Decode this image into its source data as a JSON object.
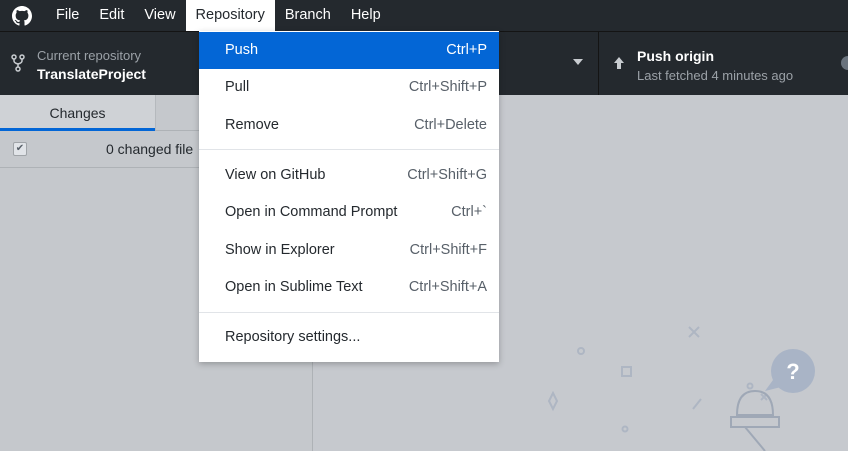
{
  "menubar": {
    "items": [
      {
        "label": "File"
      },
      {
        "label": "Edit"
      },
      {
        "label": "View"
      },
      {
        "label": "Repository",
        "active": true
      },
      {
        "label": "Branch"
      },
      {
        "label": "Help"
      }
    ]
  },
  "toolbar": {
    "repo_caption": "Current repository",
    "repo_name": "TranslateProject",
    "push_title": "Push origin",
    "push_subtitle": "Last fetched 4 minutes ago"
  },
  "sidebar": {
    "tab_changes": "Changes",
    "changed_files": "0 changed file"
  },
  "repository_menu": {
    "items": [
      {
        "label": "Push",
        "shortcut": "Ctrl+P",
        "highlighted": true
      },
      {
        "label": "Pull",
        "shortcut": "Ctrl+Shift+P"
      },
      {
        "label": "Remove",
        "shortcut": "Ctrl+Delete"
      },
      {
        "label": "View on GitHub",
        "shortcut": "Ctrl+Shift+G"
      },
      {
        "label": "Open in Command Prompt",
        "shortcut": "Ctrl+`"
      },
      {
        "label": "Show in Explorer",
        "shortcut": "Ctrl+Shift+F"
      },
      {
        "label": "Open in Sublime Text",
        "shortcut": "Ctrl+Shift+A"
      },
      {
        "label": "Repository settings..."
      }
    ]
  },
  "colors": {
    "titlebar": "#24292e",
    "accent": "#0366d6",
    "overlay": "#c6c9ce"
  }
}
